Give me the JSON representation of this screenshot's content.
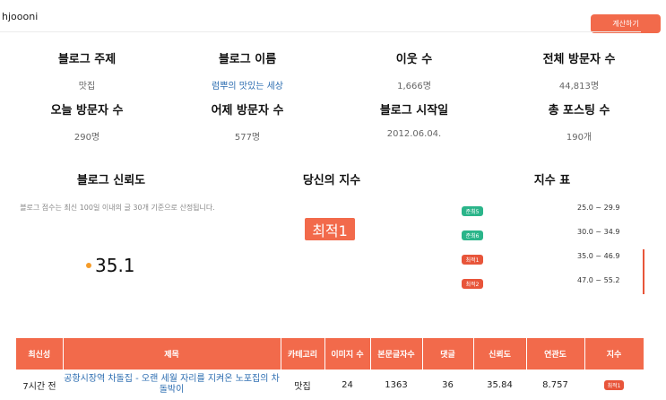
{
  "header": {
    "username": "hjoooni",
    "calc_button": "계산하기"
  },
  "stats": [
    {
      "title": "블로그 주제",
      "value": "맛집"
    },
    {
      "title": "블로그 이름",
      "value": "럼뿌의 맛있는 세상"
    },
    {
      "title": "이웃 수",
      "value": "1,666명"
    },
    {
      "title": "전체 방문자 수",
      "value": "44,813명"
    },
    {
      "title": "오늘 방문자 수",
      "value": "290명"
    },
    {
      "title": "어제 방문자 수",
      "value": "577명"
    },
    {
      "title": "블로그 시작일",
      "value": "2012.06.04."
    },
    {
      "title": "총 포스팅 수",
      "value": "190개"
    }
  ],
  "trust": {
    "title": "블로그 신뢰도",
    "note": "블로그 점수는 최신 100일 이내의 글 30개 기준으로 산정됩니다.",
    "score": "35.1"
  },
  "index": {
    "title": "당신의 지수",
    "badge": "최적1"
  },
  "index_table": {
    "title": "지수 표",
    "rows": [
      {
        "label": "준최5",
        "range": "25.0 ~ 29.9",
        "color": "#2bb58a"
      },
      {
        "label": "준최6",
        "range": "30.0 ~ 34.9",
        "color": "#2bb58a"
      },
      {
        "label": "최적1",
        "range": "35.0 ~ 46.9",
        "color": "#e8553a"
      },
      {
        "label": "최적2",
        "range": "47.0 ~ 55.2",
        "color": "#e8553a"
      }
    ]
  },
  "results": {
    "headers": [
      "최신성",
      "제목",
      "카테고리",
      "이미지 수",
      "본문글자수",
      "댓글",
      "신뢰도",
      "연관도",
      "지수"
    ],
    "rows": [
      {
        "recency": "7시간 전",
        "title": "공항시장역 차돌집 - 오랜 세월 자리를 지켜온 노포집의 차돌박이",
        "category": "맛집",
        "images": "24",
        "chars": "1363",
        "comments": "36",
        "trust": "35.84",
        "relevance": "8.757",
        "index": "최적1"
      }
    ]
  }
}
